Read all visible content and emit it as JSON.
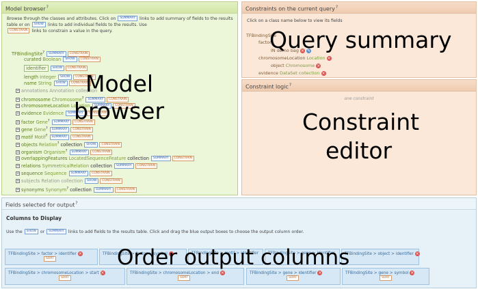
{
  "model_browser": {
    "title": "Model browser",
    "help": "?",
    "intro_1": "Browse through the classes and attributes. Click on",
    "intro_2": "links to add summary of fields to the results table or on",
    "intro_3": "links to add individual fields to the results. Use",
    "intro_4": "links to constrain a value in the query.",
    "summary_btn": "SUMMARY",
    "show_btn": "SHOW",
    "constrain_btn": "CONSTRAIN",
    "root": "TFBindingSite",
    "attrs": [
      {
        "name": "curated",
        "type": "Boolean"
      },
      {
        "name": "identifier",
        "type": ""
      },
      {
        "name": "length",
        "type": "Integer"
      },
      {
        "name": "name",
        "type": "String"
      }
    ],
    "refs": [
      {
        "name": "annotations",
        "type": "Annotation",
        "suffix": "collection"
      },
      {
        "name": "chromosome",
        "type": "Chromosome",
        "suffix": ""
      },
      {
        "name": "chromosomeLocation",
        "type": "Location",
        "suffix": ""
      },
      {
        "name": "evidence",
        "type": "Evidence",
        "suffix": ""
      },
      {
        "name": "factor",
        "type": "Gene",
        "suffix": ""
      },
      {
        "name": "gene",
        "type": "Gene",
        "suffix": ""
      },
      {
        "name": "motif",
        "type": "Motif",
        "suffix": ""
      },
      {
        "name": "objects",
        "type": "Relation",
        "suffix": "collection"
      },
      {
        "name": "organism",
        "type": "Organism",
        "suffix": ""
      },
      {
        "name": "overlappingFeatures",
        "type": "LocatedSequenceFeature",
        "suffix": "collection"
      },
      {
        "name": "relations",
        "type": "SymmetricalRelation",
        "suffix": "collection"
      },
      {
        "name": "sequence",
        "type": "Sequence",
        "suffix": ""
      },
      {
        "name": "subjects",
        "type": "Relation",
        "suffix": "collection"
      },
      {
        "name": "synonyms",
        "type": "Synonym",
        "suffix": "collection"
      }
    ]
  },
  "constraints": {
    "title": "Constraints on the current query",
    "help": "?",
    "intro": "Click on a class name below to view its fields",
    "root": "TFBindingSite",
    "factor": "factor",
    "in_constraint": "IN demo bag",
    "chromloc": "chromosomeLocation",
    "chromloc_type": "Location",
    "object": "object",
    "object_type": "Chromosome",
    "evidence": "evidence",
    "evidence_type": "DataSet collection"
  },
  "logic": {
    "title": "Constraint logic",
    "help": "?",
    "text": "one constraint"
  },
  "fields": {
    "title": "Fields selected for output",
    "help": "?",
    "heading": "Columns to Display",
    "use": "Use the",
    "or": "or",
    "rest": "links to add fields to the results table. Click and drag the blue output boxes to choose the output column order.",
    "sort": "SORT",
    "columns": [
      "TFBindingSite > factor > identifier",
      "TFBindingSite > factor > symbol",
      "TFBindingSite > motif > identifier",
      "TFBindingSite > gene > identifier",
      "TFBindingSite > object > identifier",
      "TFBindingSite > chromosomeLocation > start",
      "TFBindingSite > chromosomeLocation > end",
      "TFBindingSite > gene > identifier",
      "TFBindingSite > gene > symbol"
    ]
  },
  "overlays": {
    "model": "Model",
    "browser": "browser",
    "query": "Query summary",
    "constraint": "Constraint",
    "editor": "editor",
    "order": "Order output columns"
  }
}
